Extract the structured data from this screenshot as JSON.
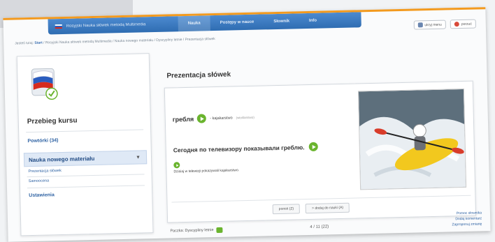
{
  "topbar": {
    "course_title": "Rosyjski Nauka słówek metodą Multimedia",
    "tabs": [
      "Nauka",
      "Postępy w nauce",
      "Słownik",
      "Info"
    ],
    "flag_colors": [
      "#ffffff",
      "#2a5cbf",
      "#d52b1e"
    ]
  },
  "right_buttons": {
    "menu_label": "ukryj menu",
    "close_label": "porzuć"
  },
  "breadcrumb": {
    "prefix": "Jesteś tutaj:",
    "start": "Start",
    "path": "/ Rosyjski Nauka słówek metodą Multimedia / Nauka nowego materiału / Dyscypliny letnie / Prezentacja słówek"
  },
  "sidebar": {
    "title": "Przebieg kursu",
    "review": "Powtórki (34)",
    "active_item": "Nauka nowego materiału",
    "sub_items": [
      "Prezentacja słówek",
      "Samoocena"
    ],
    "settings": "Ustawienia"
  },
  "main": {
    "title": "Prezentacja słówek",
    "word_ru": "гребля",
    "word_pl": "- kajakarstwo",
    "word_extra": "(wioślarstwo)",
    "sentence_ru": "Сегодня по телевизору показывали греблю.",
    "sentence_pl": "Dzisiaj w telewizji pokazywali kajakarstwo.",
    "btn_prev": "pomiń (Z)",
    "btn_next": "> dodaj do nauki (A)"
  },
  "footer": {
    "left": "Paczka: Dyscypliny letnie",
    "pager": "4 / 11 (22)",
    "links": [
      "Pomoc słownika",
      "Dodaj komentarz",
      "Zaproponuj zmianę"
    ]
  },
  "accent_colors": {
    "brand_blue": "#2f6db2",
    "orange_rule": "#f39a1e",
    "play_green": "#6ab42e"
  }
}
